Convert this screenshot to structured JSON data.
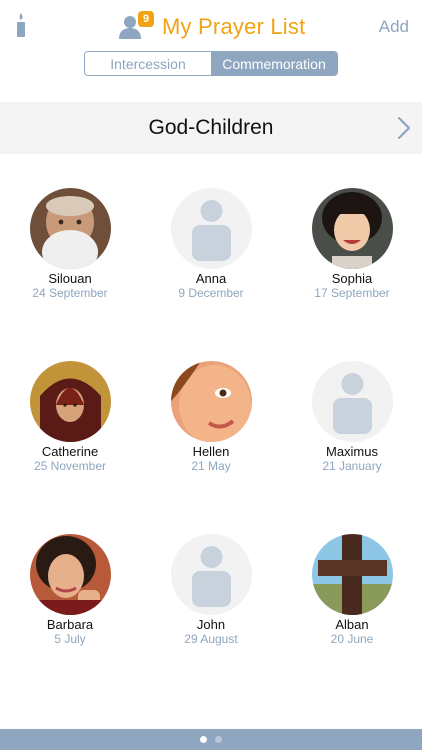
{
  "header": {
    "title": "My Prayer List",
    "badge_count": "9",
    "add_label": "Add"
  },
  "segments": {
    "intercession": "Intercession",
    "commemoration": "Commemoration",
    "selected": "Commemoration"
  },
  "group": {
    "title": "God-Children"
  },
  "people": [
    {
      "name": "Silouan",
      "date": "24 September",
      "avatar": "photo-old-man"
    },
    {
      "name": "Anna",
      "date": "9 December",
      "avatar": "placeholder-person"
    },
    {
      "name": "Sophia",
      "date": "17 September",
      "avatar": "photo-child-girl"
    },
    {
      "name": "Catherine",
      "date": "25 November",
      "avatar": "photo-icon-painting"
    },
    {
      "name": "Hellen",
      "date": "21 May",
      "avatar": "photo-girl-face"
    },
    {
      "name": "Maximus",
      "date": "21 January",
      "avatar": "placeholder-person"
    },
    {
      "name": "Barbara",
      "date": "5 July",
      "avatar": "photo-young-woman"
    },
    {
      "name": "John",
      "date": "29 August",
      "avatar": "placeholder-person"
    },
    {
      "name": "Alban",
      "date": "20 June",
      "avatar": "photo-wooden-cross"
    }
  ],
  "pager": {
    "current_page": 1,
    "total_pages": 2
  },
  "colors": {
    "accent": "#f0a312",
    "steel_blue": "#8ea6bf",
    "group_bar": "#f4f4f4"
  }
}
